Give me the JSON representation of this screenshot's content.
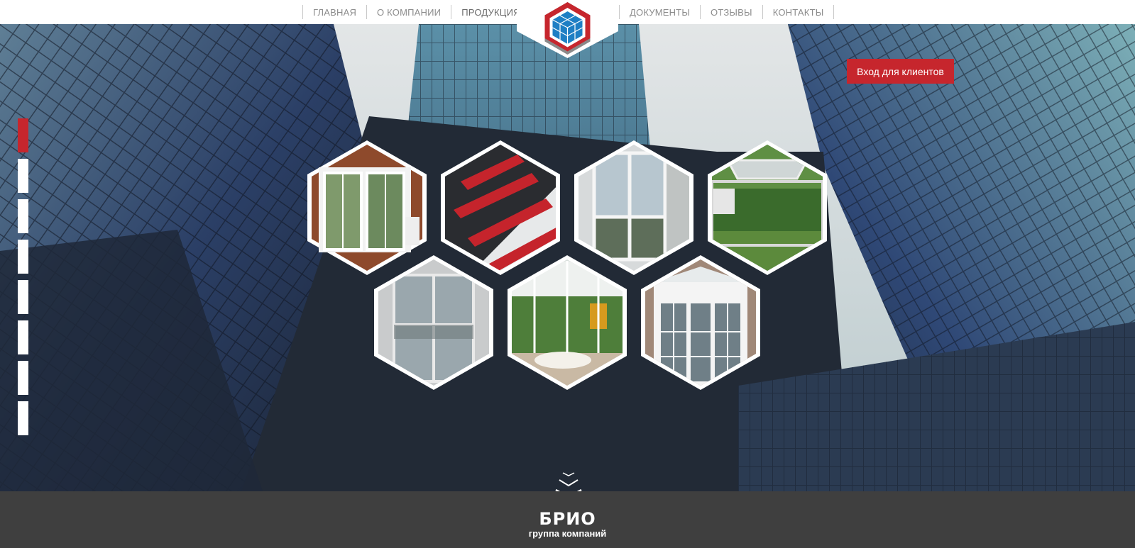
{
  "nav": {
    "left": [
      "ГЛАВНАЯ",
      "О КОМПАНИИ",
      "ПРОДУКЦИЯ"
    ],
    "right": [
      "ДОКУМЕНТЫ",
      "ОТЗЫВЫ",
      "КОНТАКТЫ"
    ],
    "active": "ПРОДУКЦИЯ"
  },
  "logo": {
    "icon": "hexagon-cube-logo",
    "colors": [
      "#c6262d",
      "#1e7fc4",
      "#8a8a8a"
    ]
  },
  "hero": {
    "client_button": "Вход для клиентов",
    "slide_count": 8,
    "active_slide": 1,
    "product_tiles": [
      "white-balcony-doors",
      "red-facade-building",
      "glazed-balcony",
      "tilt-window",
      "aluminium-entrance-doors",
      "winter-garden",
      "white-french-doors"
    ],
    "scroll_icon": "double-chevron-down-icon"
  },
  "footer": {
    "brand": "БРИО",
    "tagline": "группа компаний"
  },
  "colors": {
    "accent": "#c6262d",
    "footer_bg": "#3f3f3f",
    "hero_dark": "#2a3340"
  }
}
